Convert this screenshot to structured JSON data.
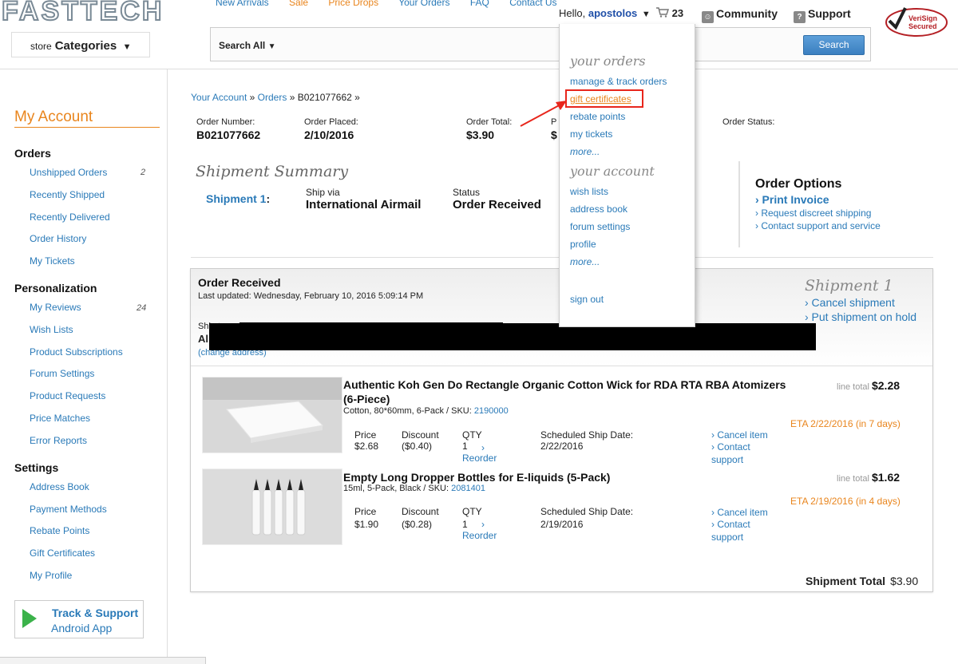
{
  "header": {
    "logo": "FASTTECH",
    "nav": [
      "New Arrivals",
      "Sale",
      "Price Drops",
      "Your Orders",
      "FAQ",
      "Contact Us"
    ],
    "hello": "Hello,",
    "username": "apostolos",
    "cart_count": "23",
    "community": "Community",
    "support": "Support",
    "verisign": "VeriSign Secured",
    "categories_prefix": "store",
    "categories": "Categories",
    "search_scope": "Search All",
    "search_button": "Search"
  },
  "sidebar": {
    "title": "My Account",
    "sections": {
      "orders": "Orders",
      "personalization": "Personalization",
      "settings": "Settings"
    },
    "orders_items": [
      "Unshipped Orders",
      "Recently Shipped",
      "Recently Delivered",
      "Order History",
      "My Tickets"
    ],
    "unshipped_count": "2",
    "personalization_items": [
      "My Reviews",
      "Wish Lists",
      "Product Subscriptions",
      "Forum Settings",
      "Product Requests",
      "Price Matches",
      "Error Reports"
    ],
    "reviews_count": "24",
    "settings_items": [
      "Address Book",
      "Payment Methods",
      "Rebate Points",
      "Gift Certificates",
      "My Profile"
    ],
    "app_line1": "Track & Support",
    "app_line2": "Android App"
  },
  "breadcrumb": {
    "account": "Your Account",
    "orders": "Orders",
    "order_id": "B021077662",
    "sep": "»"
  },
  "order": {
    "number_label": "Order Number:",
    "number": "B021077662",
    "placed_label": "Order Placed:",
    "placed": "2/10/2016",
    "total_label": "Order Total:",
    "total": "$3.90",
    "p_label": "P",
    "p_value": "$",
    "status_label": "Order Status:"
  },
  "shipment_summary": {
    "title": "Shipment Summary",
    "shipment": "Shipment 1",
    "colon": ":",
    "shipvia_label": "Ship via",
    "shipvia": "International Airmail",
    "status_label": "Status",
    "status": "Order Received"
  },
  "order_options": {
    "title": "Order Options",
    "print": "› Print Invoice",
    "discreet": "› Request discreet shipping",
    "contact": "› Contact support and service"
  },
  "panel": {
    "status": "Order Received",
    "updated": "Last updated: Wednesday, February 10, 2016 5:09:14 PM",
    "ship_to_label": "Ship t",
    "ship_to_name": "Al",
    "change_address": "(change address)",
    "shipment_title": "Shipment 1",
    "cancel_shipment": "› Cancel shipment",
    "hold_shipment": "› Put shipment on hold",
    "items": [
      {
        "title": "Authentic Koh Gen Do Rectangle Organic Cotton Wick for RDA RTA RBA Atomizers (6-Piece)",
        "sub": "Cotton, 80*60mm, 6-Pack / SKU:",
        "sku": "2190000",
        "price_label": "Price",
        "price": "$2.68",
        "discount_label": "Discount",
        "discount": "($0.40)",
        "qty_label": "QTY",
        "qty": "1",
        "reorder": "Reorder",
        "ship_label": "Scheduled Ship Date:",
        "ship_date": "2/22/2016",
        "cancel": "› Cancel item",
        "contact": "› Contact",
        "support": "support",
        "line_total_label": "line total",
        "line_total": "$2.28",
        "eta": "ETA 2/22/2016 (in 7 days)"
      },
      {
        "title": "Empty Long Dropper Bottles for E-liquids (5-Pack)",
        "sub": "15ml, 5-Pack, Black / SKU:",
        "sku": "2081401",
        "price_label": "Price",
        "price": "$1.90",
        "discount_label": "Discount",
        "discount": "($0.28)",
        "qty_label": "QTY",
        "qty": "1",
        "reorder": "Reorder",
        "ship_label": "Scheduled Ship Date:",
        "ship_date": "2/19/2016",
        "cancel": "› Cancel item",
        "contact": "› Contact",
        "support": "support",
        "line_total_label": "line total",
        "line_total": "$1.62",
        "eta": "ETA 2/19/2016 (in 4 days)"
      }
    ],
    "shipment_total_label": "Shipment Total",
    "shipment_total": "$3.90"
  },
  "dropdown": {
    "orders_head": "your orders",
    "orders_items": [
      "manage & track orders",
      "gift certificates",
      "rebate points",
      "my tickets",
      "more..."
    ],
    "account_head": "your account",
    "account_items": [
      "wish lists",
      "address book",
      "forum settings",
      "profile",
      "more..."
    ],
    "signout": "sign out"
  },
  "colors": {
    "accent_orange": "#e9851d",
    "link_blue": "#2a7ab8",
    "highlight_red": "#e8261c"
  }
}
